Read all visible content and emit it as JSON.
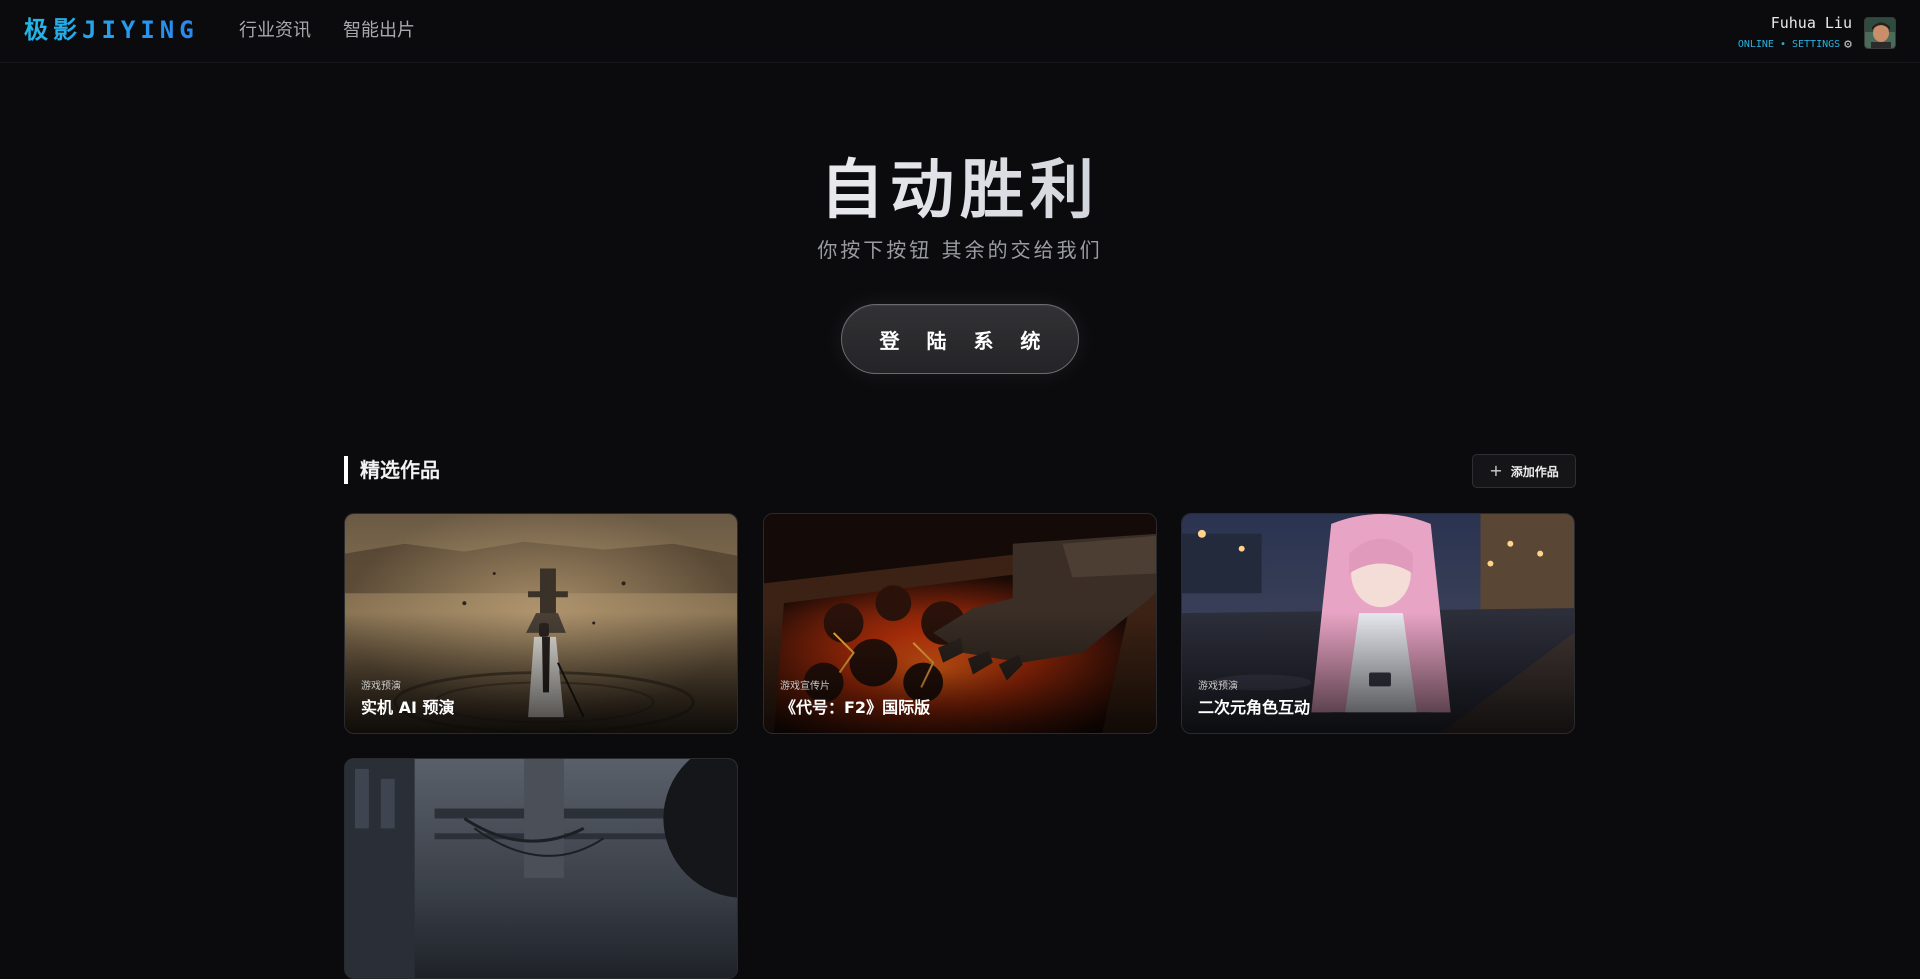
{
  "header": {
    "logo": "极影JIYING",
    "nav": [
      {
        "label": "行业资讯"
      },
      {
        "label": "智能出片"
      }
    ],
    "user": {
      "name": "Fuhua Liu",
      "status": "ONLINE • SETTINGS"
    }
  },
  "hero": {
    "title": "自动胜利",
    "subtitle": "你按下按钮 其余的交给我们",
    "login_label": "登 陆 系 统"
  },
  "featured": {
    "title": "精选作品",
    "add_label": "添加作品",
    "cards": [
      {
        "category": "游戏预演",
        "title": "实机 AI 预演"
      },
      {
        "category": "游戏宣传片",
        "title": "《代号：F2》国际版"
      },
      {
        "category": "游戏预演",
        "title": "二次元角色互动"
      },
      {
        "category": "",
        "title": ""
      }
    ]
  },
  "colors": {
    "background": "#0b0b0d",
    "accent": "#19a4e0",
    "card_border": "#2a2b2f"
  },
  "icons": [
    "gear-icon",
    "plus-icon",
    "avatar"
  ]
}
